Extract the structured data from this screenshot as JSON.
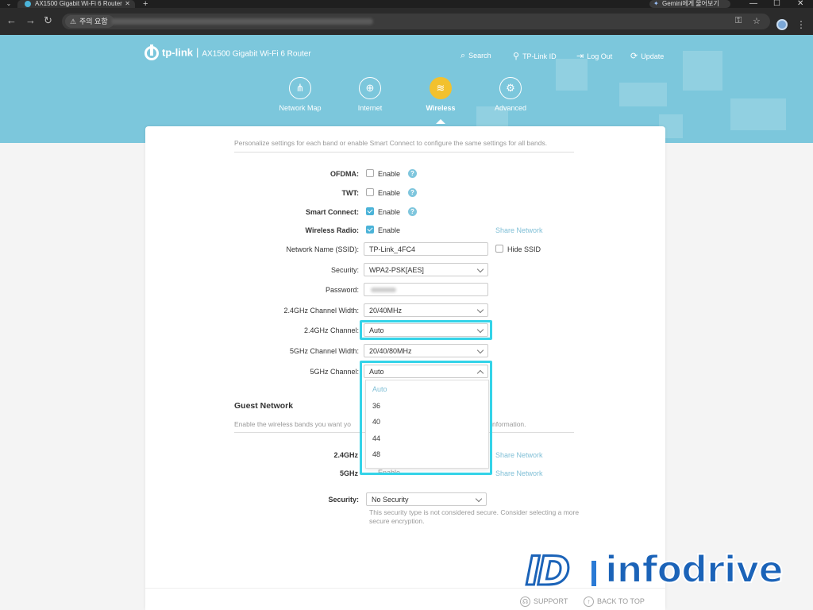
{
  "browser": {
    "tab_title": "AX1500 Gigabit Wi-Fi 6 Router",
    "tab_close": "✕",
    "new_tab": "+",
    "gemini_label": "Gemini에게 물어보기",
    "security_chip": "주의 요함",
    "window_controls": [
      "—",
      "☐",
      "✕"
    ]
  },
  "router": {
    "brand": "tp-link",
    "model": "AX1500 Gigabit Wi-Fi 6 Router",
    "header_links": [
      {
        "label": "Search",
        "icon": "search-icon"
      },
      {
        "label": "TP-Link ID",
        "icon": "user-icon"
      },
      {
        "label": "Log Out",
        "icon": "logout-icon"
      },
      {
        "label": "Update",
        "icon": "update-icon"
      }
    ],
    "nav_tabs": [
      {
        "label": "Network Map",
        "icon": "network-map-icon",
        "active": false
      },
      {
        "label": "Internet",
        "icon": "globe-icon",
        "active": false
      },
      {
        "label": "Wireless",
        "icon": "wifi-icon",
        "active": true
      },
      {
        "label": "Advanced",
        "icon": "gear-icon",
        "active": false
      }
    ],
    "accent_color": "#4bb3d8",
    "active_tab_color": "#f2c12e",
    "highlight_color": "#34d3e8"
  },
  "wireless": {
    "intro": "Personalize settings for each band or enable Smart Connect to configure the same settings for all bands.",
    "ofdma": {
      "label": "OFDMA:",
      "checkbox": "Enable",
      "checked": false
    },
    "twt": {
      "label": "TWT:",
      "checkbox": "Enable",
      "checked": false
    },
    "smart_connect": {
      "label": "Smart Connect:",
      "checkbox": "Enable",
      "checked": true
    },
    "wireless_radio": {
      "label": "Wireless Radio:",
      "checkbox": "Enable",
      "checked": true,
      "share": "Share Network"
    },
    "ssid": {
      "label": "Network Name (SSID):",
      "value": "TP-Link_4FC4",
      "hide_label": "Hide SSID"
    },
    "security": {
      "label": "Security:",
      "value": "WPA2-PSK[AES]"
    },
    "password": {
      "label": "Password:"
    },
    "ch_width_24": {
      "label": "2.4GHz Channel Width:",
      "value": "20/40MHz"
    },
    "channel_24": {
      "label": "2.4GHz Channel:",
      "value": "Auto"
    },
    "ch_width_5": {
      "label": "5GHz Channel Width:",
      "value": "20/40/80MHz"
    },
    "channel_5": {
      "label": "5GHz Channel:",
      "value": "Auto",
      "options": [
        "Auto",
        "36",
        "40",
        "44",
        "48"
      ]
    }
  },
  "guest": {
    "title": "Guest Network",
    "desc_start": "Enable the wireless bands you want yo",
    "desc_end": "nformation.",
    "band_24": {
      "label": "2.4GHz",
      "share": "Share Network"
    },
    "band_5": {
      "label": "5GHz",
      "partial": "Enable",
      "share": "Share Network"
    },
    "security": {
      "label": "Security:",
      "value": "No Security"
    },
    "note": "This security type is not considered secure. Consider selecting a more secure encryption."
  },
  "footer": {
    "support": "SUPPORT",
    "back_to_top": "BACK TO TOP"
  },
  "watermark": {
    "mark": "ID",
    "text": "infodrive"
  }
}
